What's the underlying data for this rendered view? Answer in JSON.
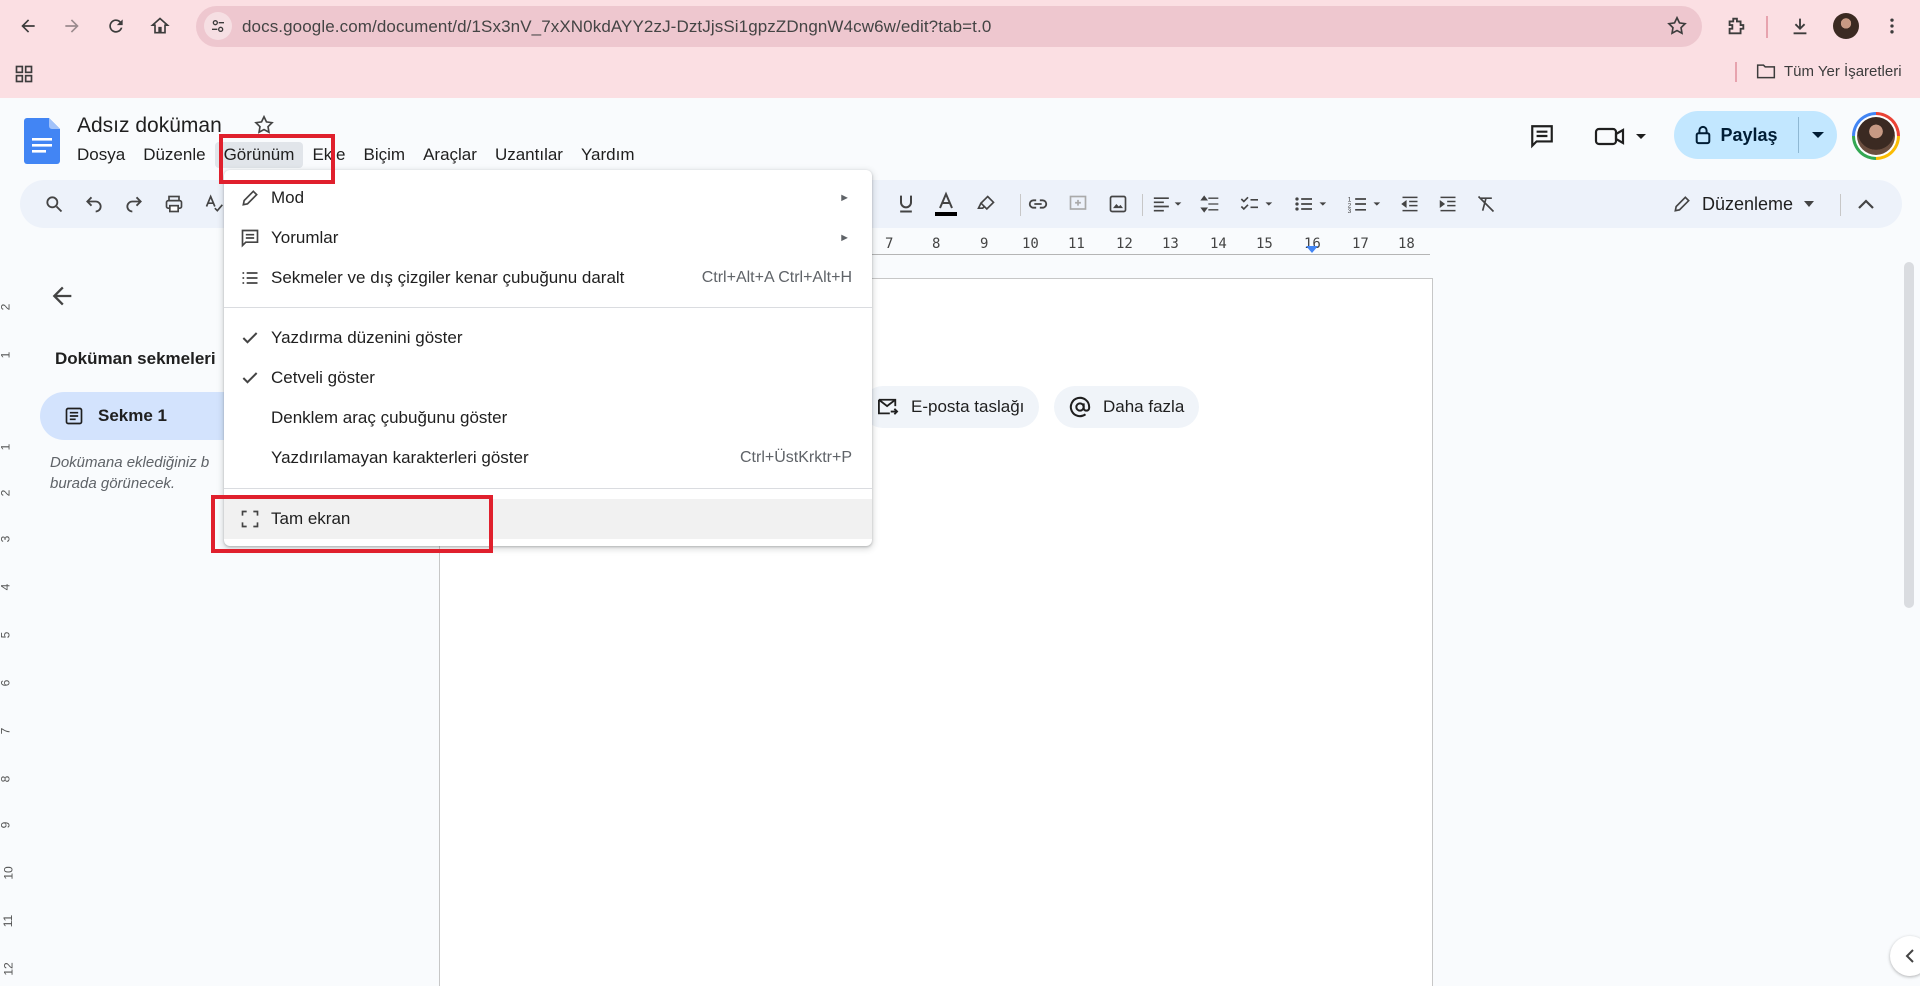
{
  "browser": {
    "url": "docs.google.com/document/d/1Sx3nV_7xXN0kdAYY2zJ-DztJjsSi1gpzZDngnW4cw6w/edit?tab=t.0",
    "bookmarks_label": "Tüm Yer İşaretleri"
  },
  "doc": {
    "title": "Adsız doküman",
    "menus": [
      "Dosya",
      "Düzenle",
      "Görünüm",
      "Ekle",
      "Biçim",
      "Araçlar",
      "Uzantılar",
      "Yardım"
    ],
    "active_menu": "Görünüm",
    "share_label": "Paylaş",
    "mode_label": "Düzenleme"
  },
  "ruler": {
    "ticks": [
      "7",
      "8",
      "9",
      "10",
      "11",
      "12",
      "13",
      "14",
      "15",
      "16",
      "17",
      "18"
    ],
    "vticks": [
      "2",
      "1",
      "1",
      "2",
      "3",
      "4",
      "5",
      "6",
      "7",
      "8",
      "9",
      "10",
      "11",
      "12"
    ]
  },
  "sidebar": {
    "heading": "Doküman sekmeleri",
    "tab_label": "Sekme 1",
    "hint": "Dokümana eklediğiniz b burada görünecek."
  },
  "page": {
    "chips": [
      "E-posta taslağı",
      "Daha fazla"
    ]
  },
  "view_menu": {
    "items": [
      {
        "label": "Mod",
        "icon": "pencil-icon",
        "submenu": true
      },
      {
        "label": "Yorumlar",
        "icon": "comment-icon",
        "submenu": true
      },
      {
        "label": "Sekmeler ve dış çizgiler kenar çubuğunu daralt",
        "icon": "list-icon",
        "shortcut": "Ctrl+Alt+A Ctrl+Alt+H"
      },
      {
        "label": "Yazdırma düzenini göster",
        "icon": "check-icon",
        "checked": true
      },
      {
        "label": "Cetveli göster",
        "icon": "check-icon",
        "checked": true
      },
      {
        "label": "Denklem araç çubuğunu göster"
      },
      {
        "label": "Yazdırılamayan karakterleri göster",
        "shortcut": "Ctrl+ÜstKrktr+P"
      },
      {
        "label": "Tam ekran",
        "icon": "fullscreen-icon",
        "highlighted": true
      }
    ]
  },
  "colors": {
    "chrome_bg": "#fbdfe3",
    "share_bg": "#c2e7ff",
    "highlight_box": "#e0202d",
    "docs_blue": "#4285f4"
  }
}
